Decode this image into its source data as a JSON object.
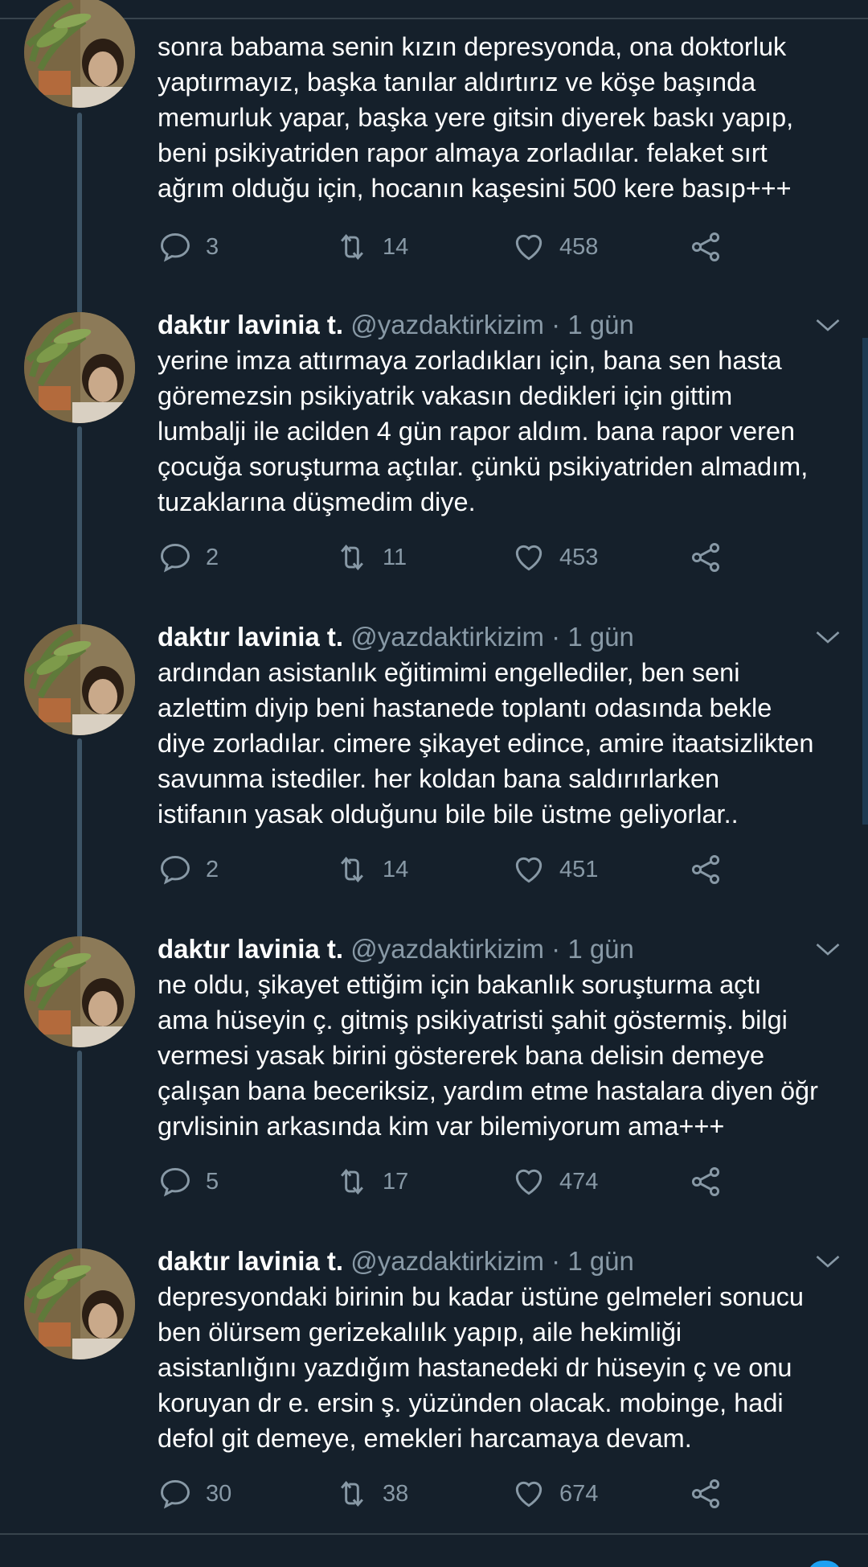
{
  "colors": {
    "background": "#15202b",
    "text": "#ffffff",
    "muted": "#8899a6",
    "divider": "#38444d",
    "accent": "#1da1f2"
  },
  "icons": {
    "reply": "reply-icon",
    "retweet": "retweet-icon",
    "like": "heart-icon",
    "share": "share-icon",
    "menu": "chevron-down-icon"
  },
  "tweets": [
    {
      "name": "",
      "handle": "",
      "separator": "",
      "time": "",
      "text": "sonra babama senin kızın depresyonda, ona doktorluk\nyaptırmayız, başka tanılar aldırtırız ve köşe başında\nmemurluk yapar, başka yere gitsin diyerek baskı yapıp,\nbeni psikiyatriden rapor almaya zorladılar. felaket sırt\nağrım olduğu için, hocanın kaşesini 500 kere basıp+++",
      "replies": "3",
      "retweets": "14",
      "likes": "458"
    },
    {
      "name": "daktır lavinia t.",
      "handle": "@yazdaktirkizim",
      "separator": "·",
      "time": "1 gün",
      "text": "yerine imza attırmaya zorladıkları için, bana sen hasta\ngöremezsin psikiyatrik vakasın dedikleri için gittim\nlumbalji ile acilden 4 gün rapor aldım. bana rapor veren\nçocuğa soruşturma açtılar. çünkü psikiyatriden almadım,\ntuzaklarına düşmedim diye.",
      "replies": "2",
      "retweets": "11",
      "likes": "453"
    },
    {
      "name": "daktır lavinia t.",
      "handle": "@yazdaktirkizim",
      "separator": "·",
      "time": "1 gün",
      "text": "ardından asistanlık eğitimimi engellediler, ben seni\nazlettim diyip beni hastanede toplantı odasında bekle\ndiye zorladılar. cimere şikayet edince, amire itaatsizlikten\nsavunma istediler. her koldan bana saldırırlarken\nistifanın yasak olduğunu bile bile üstme geliyorlar..",
      "replies": "2",
      "retweets": "14",
      "likes": "451"
    },
    {
      "name": "daktır lavinia t.",
      "handle": "@yazdaktirkizim",
      "separator": "·",
      "time": "1 gün",
      "text": "ne oldu, şikayet ettiğim için bakanlık soruşturma açtı\nama hüseyin ç. gitmiş psikiyatristi şahit göstermiş. bilgi\nvermesi yasak birini göstererek bana delisin demeye\nçalışan bana beceriksiz, yardım etme hastalara diyen öğr\ngrvlisinin arkasında kim var bilemiyorum ama+++",
      "replies": "5",
      "retweets": "17",
      "likes": "474"
    },
    {
      "name": "daktır lavinia t.",
      "handle": "@yazdaktirkizim",
      "separator": "·",
      "time": "1 gün",
      "text": "depresyondaki birinin bu kadar üstüne gelmeleri sonucu\nben ölürsem gerizekalılık yapıp, aile hekimliği\nasistanlığını yazdığım hastanedeki dr hüseyin ç ve onu\nkoruyan dr e. ersin ş. yüzünden olacak. mobinge, hadi\ndefol git demeye, emekleri harcamaya devam.",
      "replies": "30",
      "retweets": "38",
      "likes": "674"
    }
  ]
}
